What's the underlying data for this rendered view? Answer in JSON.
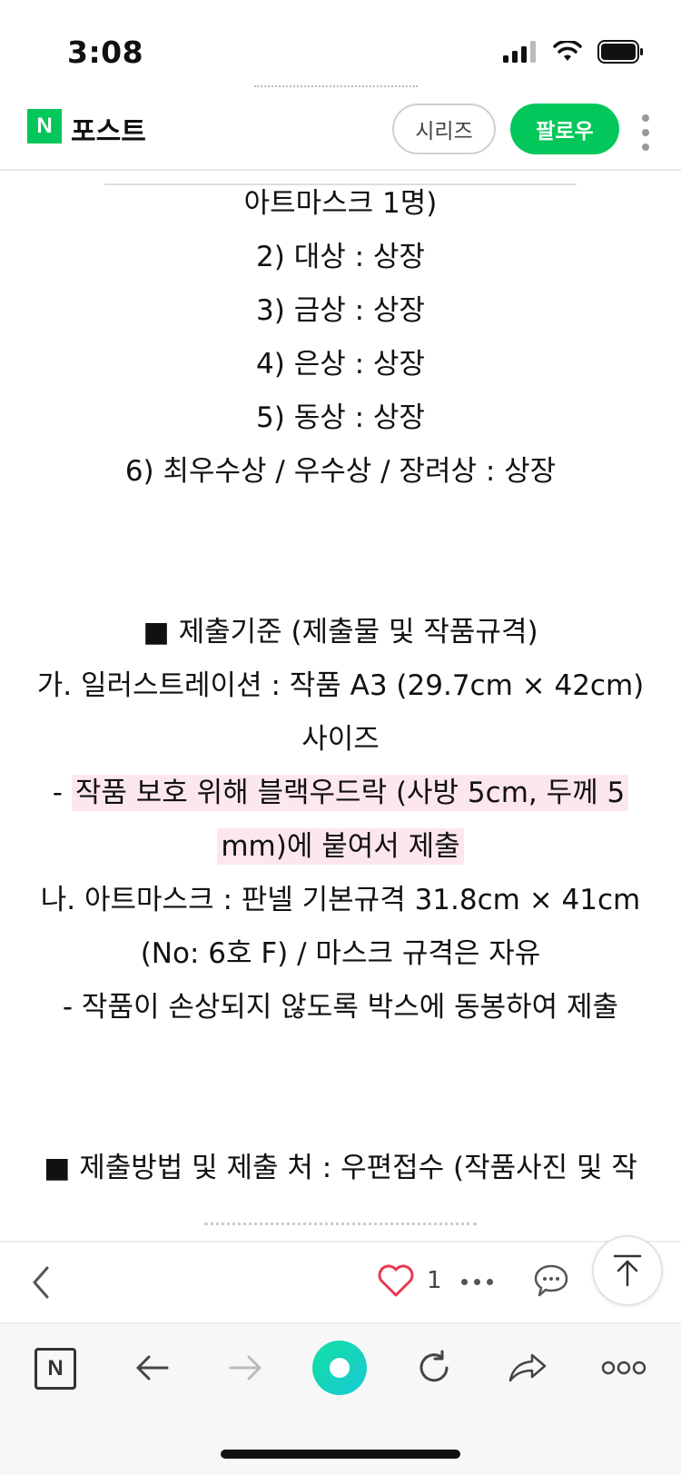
{
  "status": {
    "time": "3:08"
  },
  "header": {
    "logo_letter": "N",
    "title": "포스트",
    "series_label": "시리즈",
    "follow_label": "팔로우"
  },
  "content": {
    "lines": [
      "아트마스크 1명)",
      "2) 대상 : 상장",
      "3) 금상 : 상장",
      "4) 은상 : 상장",
      "5) 동상 : 상장",
      "6) 최우수상 / 우수상 / 장려상 : 상장",
      "■ 제출기준 (제출물 및 작품규격)",
      "가. 일러스트레이션 : 작품 A3 (29.7cm × 42cm)",
      "사이즈",
      "- ",
      "작품 보호 위해 블랙우드락 (사방 5cm, 두께 5",
      "mm)에 붙여서 제출",
      "나. 아트마스크 : 판넬 기본규격 31.8cm × 41cm",
      "(No: 6호 F) / 마스크 규격은 자유",
      "- 작품이 손상되지 않도록 박스에 동봉하여 제출",
      "■ 제출방법 및 제출 처 : 우편접수 (작품사진 및 작"
    ]
  },
  "actions": {
    "like_count": "1"
  },
  "browser": {
    "home_letter": "N"
  },
  "colors": {
    "brand_green": "#03c75a",
    "highlight_pink": "#fde7ee",
    "record_teal": "#19d3b5"
  }
}
